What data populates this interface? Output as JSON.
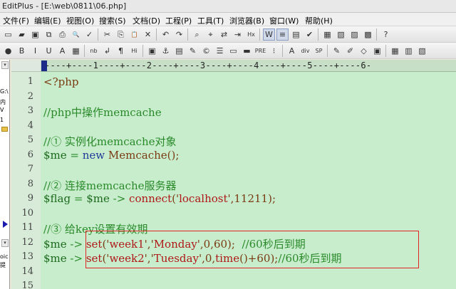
{
  "window": {
    "title": "EditPlus - [E:\\web\\0811\\06.php]"
  },
  "menu": [
    "文件(F)",
    "编辑(E)",
    "视图(O)",
    "搜索(S)",
    "文档(D)",
    "工程(P)",
    "工具(T)",
    "浏览器(B)",
    "窗口(W)",
    "帮助(H)"
  ],
  "toolbar1": {
    "buttons": [
      {
        "name": "new-icon",
        "glyph": "▭"
      },
      {
        "name": "open-icon",
        "glyph": "▰"
      },
      {
        "name": "save-icon",
        "glyph": "▣"
      },
      {
        "name": "save-all-icon",
        "glyph": "⧉"
      },
      {
        "name": "print-icon",
        "glyph": "⎙"
      },
      {
        "name": "print-preview-icon",
        "glyph": "🔍"
      },
      {
        "name": "spellcheck-icon",
        "glyph": "✓"
      },
      {
        "name": "cut-icon",
        "glyph": "✂"
      },
      {
        "name": "copy-icon",
        "glyph": "⎘"
      },
      {
        "name": "paste-icon",
        "glyph": "📋"
      },
      {
        "name": "delete-icon",
        "glyph": "✕"
      },
      {
        "name": "undo-icon",
        "glyph": "↶"
      },
      {
        "name": "redo-icon",
        "glyph": "↷"
      },
      {
        "name": "find-icon",
        "glyph": "⌕"
      },
      {
        "name": "find-next-icon",
        "glyph": "⌖"
      },
      {
        "name": "replace-icon",
        "glyph": "⇄"
      },
      {
        "name": "goto-icon",
        "glyph": "⇥"
      },
      {
        "name": "hex-icon",
        "glyph": "Hx"
      },
      {
        "name": "word-wrap-icon",
        "glyph": "W"
      },
      {
        "name": "line-number-icon",
        "glyph": "≡"
      },
      {
        "name": "ruler-icon",
        "glyph": "▤"
      },
      {
        "name": "check-icon",
        "glyph": "✔"
      },
      {
        "name": "layout-icon",
        "glyph": "▦"
      },
      {
        "name": "cliptext-icon",
        "glyph": "▧"
      },
      {
        "name": "dirs-icon",
        "glyph": "▨"
      },
      {
        "name": "output-icon",
        "glyph": "▩"
      },
      {
        "name": "help-icon",
        "glyph": "?"
      }
    ]
  },
  "toolbar2": {
    "buttons": [
      {
        "name": "format-icon",
        "glyph": "●"
      },
      {
        "name": "bold-icon",
        "glyph": "B"
      },
      {
        "name": "italic-icon",
        "glyph": "I"
      },
      {
        "name": "underline-icon",
        "glyph": "U"
      },
      {
        "name": "font-icon",
        "glyph": "A"
      },
      {
        "name": "color-icon",
        "glyph": "▦"
      },
      {
        "name": "nbsp-icon",
        "glyph": "nb"
      },
      {
        "name": "linebreak-icon",
        "glyph": "↲"
      },
      {
        "name": "paragraph-icon",
        "glyph": "¶"
      },
      {
        "name": "heading-icon",
        "glyph": "Hi"
      },
      {
        "name": "image-icon",
        "glyph": "▣"
      },
      {
        "name": "anchor-icon",
        "glyph": "⚓"
      },
      {
        "name": "table-icon",
        "glyph": "▤"
      },
      {
        "name": "edit-icon",
        "glyph": "✎"
      },
      {
        "name": "comment-icon",
        "glyph": "©"
      },
      {
        "name": "list-icon",
        "glyph": "☰"
      },
      {
        "name": "form-icon",
        "glyph": "▭"
      },
      {
        "name": "hr-icon",
        "glyph": "▬"
      },
      {
        "name": "pre-icon",
        "glyph": "PRE"
      },
      {
        "name": "indent-icon",
        "glyph": "⁝"
      },
      {
        "name": "font-size-icon",
        "glyph": "A"
      },
      {
        "name": "div-icon",
        "glyph": "div"
      },
      {
        "name": "sp-icon",
        "glyph": "SP"
      },
      {
        "name": "pen-icon",
        "glyph": "✎"
      },
      {
        "name": "brush-icon",
        "glyph": "✐"
      },
      {
        "name": "tag-icon",
        "glyph": "◇"
      },
      {
        "name": "frame-icon",
        "glyph": "▣"
      },
      {
        "name": "grid-icon",
        "glyph": "▦"
      },
      {
        "name": "preview-icon",
        "glyph": "▥"
      },
      {
        "name": "browser-icon",
        "glyph": "▧"
      }
    ]
  },
  "left_panel": {
    "fragments": [
      "G:\\",
      "内",
      "V",
      "1",
      "oic",
      "提"
    ]
  },
  "ruler_text": "----+----1----+----2----+----3----+----4----+----5----+----6-",
  "lines": [
    {
      "n": "1",
      "parts": [
        {
          "t": "<?php",
          "c": "c-default"
        }
      ]
    },
    {
      "n": "2",
      "parts": []
    },
    {
      "n": "3",
      "parts": [
        {
          "t": "//php中操作memcache",
          "c": "c-comment"
        }
      ]
    },
    {
      "n": "4",
      "parts": []
    },
    {
      "n": "5",
      "parts": [
        {
          "t": "//① 实例化memcache对象",
          "c": "c-comment"
        }
      ]
    },
    {
      "n": "6",
      "parts": [
        {
          "t": "$me",
          "c": "c-var"
        },
        {
          "t": " = ",
          "c": "c-comment"
        },
        {
          "t": "new",
          "c": "c-blue"
        },
        {
          "t": " Memcache();",
          "c": "c-default"
        }
      ]
    },
    {
      "n": "7",
      "parts": []
    },
    {
      "n": "8",
      "parts": [
        {
          "t": "//② 连接memcache服务器",
          "c": "c-comment"
        }
      ]
    },
    {
      "n": "9",
      "parts": [
        {
          "t": "$flag",
          "c": "c-var"
        },
        {
          "t": " = ",
          "c": "c-comment"
        },
        {
          "t": "$me",
          "c": "c-var"
        },
        {
          "t": " -> ",
          "c": "c-comment"
        },
        {
          "t": "connect",
          "c": "c-red"
        },
        {
          "t": "('",
          "c": "c-default"
        },
        {
          "t": "localhost",
          "c": "c-red"
        },
        {
          "t": "',11211);",
          "c": "c-default"
        }
      ]
    },
    {
      "n": "10",
      "parts": []
    },
    {
      "n": "11",
      "parts": [
        {
          "t": "//③ 给key设置有效期",
          "c": "c-comment"
        }
      ]
    },
    {
      "n": "12",
      "parts": [
        {
          "t": "$me",
          "c": "c-var"
        },
        {
          "t": " -> ",
          "c": "c-comment"
        },
        {
          "t": "set",
          "c": "c-red"
        },
        {
          "t": "('",
          "c": "c-default"
        },
        {
          "t": "week1",
          "c": "c-red"
        },
        {
          "t": "','",
          "c": "c-default"
        },
        {
          "t": "Monday",
          "c": "c-red"
        },
        {
          "t": "',0,60);  ",
          "c": "c-default"
        },
        {
          "t": "//60秒后到期",
          "c": "c-comment"
        }
      ]
    },
    {
      "n": "13",
      "parts": [
        {
          "t": "$me",
          "c": "c-var"
        },
        {
          "t": " -> ",
          "c": "c-comment"
        },
        {
          "t": "set",
          "c": "c-red"
        },
        {
          "t": "('",
          "c": "c-default"
        },
        {
          "t": "week2",
          "c": "c-red"
        },
        {
          "t": "','",
          "c": "c-default"
        },
        {
          "t": "Tuesday",
          "c": "c-red"
        },
        {
          "t": "',0,",
          "c": "c-default"
        },
        {
          "t": "time",
          "c": "c-red"
        },
        {
          "t": "()+60);",
          "c": "c-default"
        },
        {
          "t": "//60秒后到期",
          "c": "c-comment"
        }
      ]
    },
    {
      "n": "14",
      "parts": []
    },
    {
      "n": "15",
      "parts": []
    }
  ],
  "colors": {
    "editor_bg": "#c7edcc",
    "gutter_bg": "#d8ebd8",
    "comment": "#2a8a2a",
    "keyword_red": "#b01818",
    "highlight_box": "#e02424"
  }
}
